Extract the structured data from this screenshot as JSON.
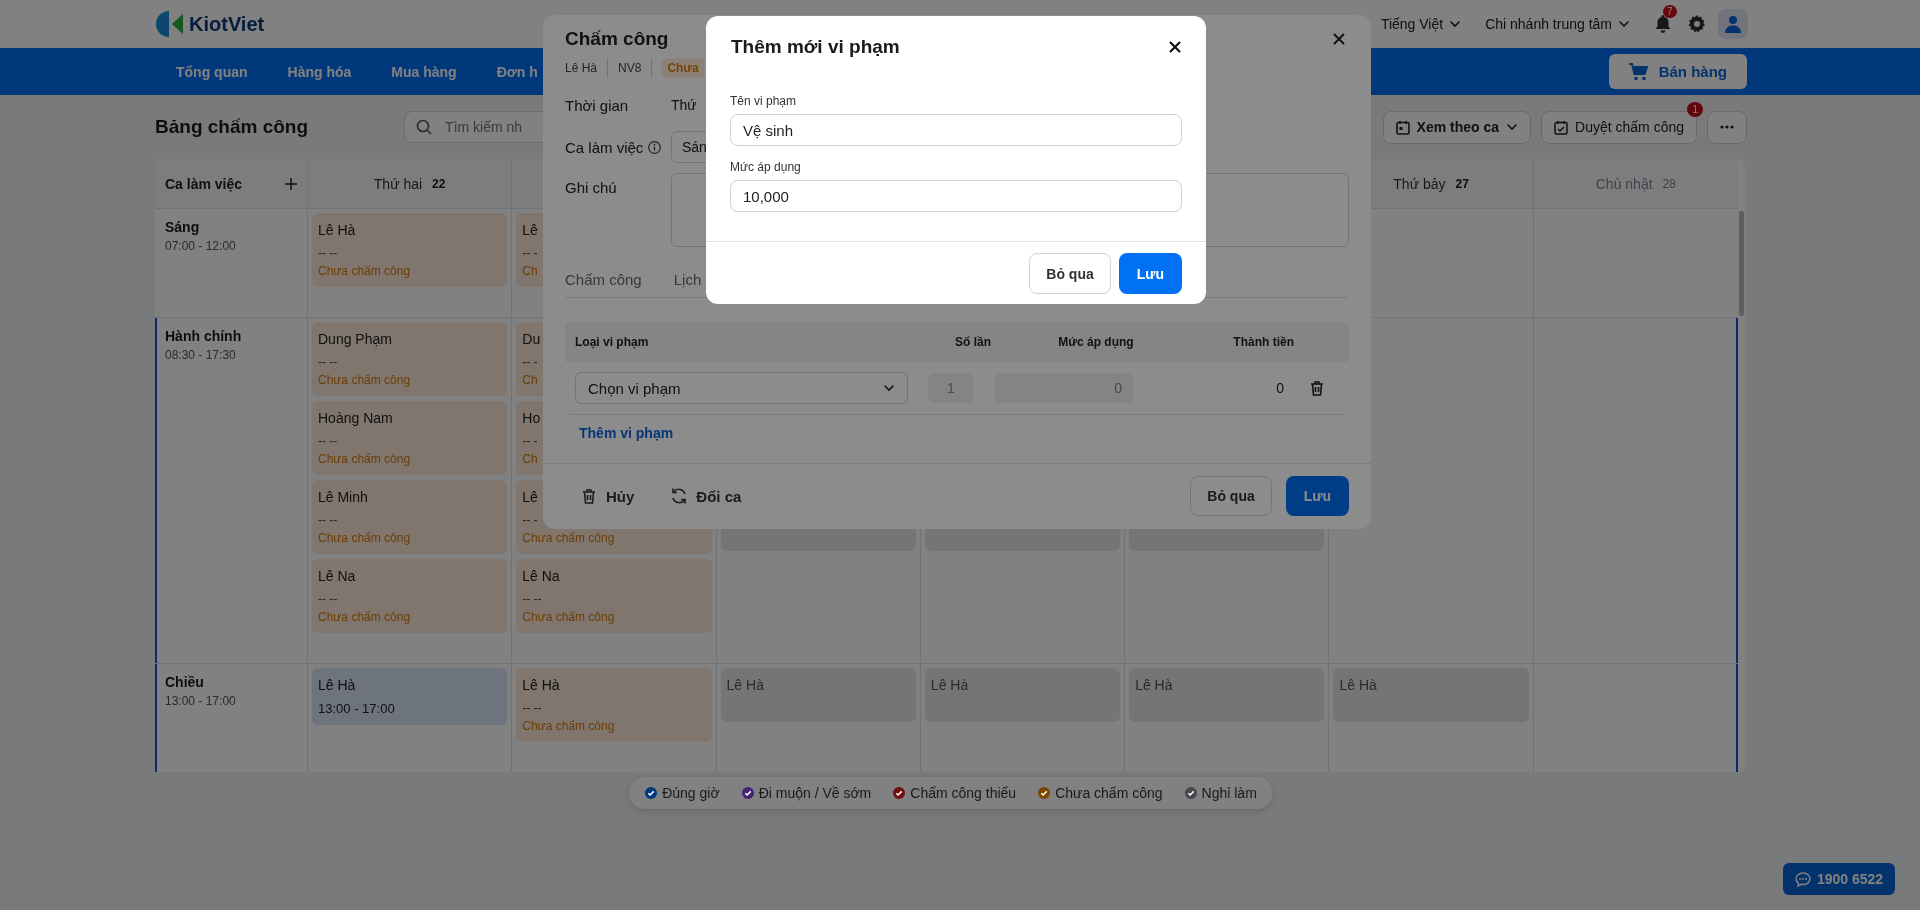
{
  "header": {
    "logo": "KiotViet",
    "language": "Tiếng Việt",
    "branch": "Chi nhánh trung tâm",
    "notification_count": "7"
  },
  "nav": {
    "items": [
      {
        "label": "Tổng quan"
      },
      {
        "label": "Hàng hóa"
      },
      {
        "label": "Mua hàng"
      },
      {
        "label": "Đơn h"
      }
    ],
    "sell_button": "Bán hàng"
  },
  "toolbar": {
    "title": "Bảng chấm công",
    "search": {
      "placeholder": "Tìm kiếm nh"
    },
    "view_button": "Xem theo ca",
    "approve_button": "Duyệt chấm công",
    "approve_badge": "1"
  },
  "schedule": {
    "shift_header": "Ca làm việc",
    "days_start": [
      {
        "name": "Thứ hai",
        "date": "22",
        "muted": false
      }
    ],
    "days_end": [
      {
        "name": "Thứ bảy",
        "date": "27",
        "muted": false
      },
      {
        "name": "Chủ nhật",
        "date": "28",
        "muted": true
      }
    ],
    "shifts": [
      {
        "name": "Sáng",
        "time": "07:00 - 12:00",
        "highlighted": false,
        "cells": [
          [
            {
              "kind": "pending",
              "name": "Lê Hà",
              "time": "-- --",
              "status": "Chưa chấm công"
            }
          ],
          [
            {
              "kind": "pending",
              "name": "Lê",
              "time": "-- -",
              "status": "Ch"
            }
          ],
          [],
          [],
          [],
          [],
          []
        ]
      },
      {
        "name": "Hành chính",
        "time": "08:30 - 17:30",
        "highlighted": true,
        "cells": [
          [
            {
              "kind": "pending",
              "name": "Dung Phạm",
              "time": "-- --",
              "status": "Chưa chấm công"
            },
            {
              "kind": "pending",
              "name": "Hoàng Nam",
              "time": "-- --",
              "status": "Chưa chấm công"
            },
            {
              "kind": "pending",
              "name": "Lê Minh",
              "time": "-- --",
              "status": "Chưa chấm công"
            },
            {
              "kind": "pending",
              "name": "Lê Na",
              "time": "-- --",
              "status": "Chưa chấm công"
            }
          ],
          [
            {
              "kind": "pending",
              "name": "Du",
              "time": "-- -",
              "status": "Ch"
            },
            {
              "kind": "pending",
              "name": "Ho",
              "time": "-- -",
              "status": "Ch"
            },
            {
              "kind": "pending",
              "name": "Lê",
              "time": "-- -",
              "status": "Chưa chấm công"
            },
            {
              "kind": "pending",
              "name": "Lê Na",
              "time": "-- --",
              "status": "Chưa chấm công"
            }
          ],
          [
            {
              "kind": "blank"
            }
          ],
          [
            {
              "kind": "blank"
            }
          ],
          [
            {
              "kind": "blank"
            }
          ],
          [],
          []
        ]
      },
      {
        "name": "Chiều",
        "time": "13:00 - 17:00",
        "highlighted": true,
        "cells": [
          [
            {
              "kind": "done",
              "name": "Lê Hà",
              "time": "13:00 - 17:00"
            }
          ],
          [
            {
              "kind": "pending",
              "name": "Lê Hà",
              "time": "-- --",
              "status": "Chưa chấm công"
            }
          ],
          [
            {
              "kind": "off",
              "name": "Lê Hà"
            }
          ],
          [
            {
              "kind": "off",
              "name": "Lê Hà"
            }
          ],
          [
            {
              "kind": "off",
              "name": "Lê Hà"
            }
          ],
          [
            {
              "kind": "off",
              "name": "Lê Hà"
            }
          ],
          []
        ]
      }
    ]
  },
  "legend": [
    {
      "label": "Đúng giờ",
      "color": "#00397b"
    },
    {
      "label": "Đi muộn / Về sớm",
      "color": "#462071"
    },
    {
      "label": "Chấm công thiếu",
      "color": "#71100f"
    },
    {
      "label": "Chưa chấm công",
      "color": "#794700"
    },
    {
      "label": "Nghỉ làm",
      "color": "#46484d"
    }
  ],
  "hotline": "1900 6522",
  "attendance_dialog": {
    "title": "Chấm công",
    "employee": "Lê Hà",
    "code": "NV8",
    "status": "Chưa",
    "time_label": "Thời gian",
    "time_value": "Thứ",
    "shift_label": "Ca làm việc",
    "shift_value": "Sán",
    "note_label": "Ghi chú",
    "tabs": [
      {
        "label": "Chấm công",
        "selected": false
      },
      {
        "label": "Lịch",
        "selected": false
      }
    ],
    "violation_columns": [
      "Loại vi phạm",
      "Số lần",
      "Mức áp dụng",
      "Thành tiền"
    ],
    "violations": [
      {
        "type": "Chọn vi phạm",
        "count": "1",
        "rate": "0",
        "amount": "0"
      }
    ],
    "add_link": "Thêm vi phạm",
    "delete_button": "Hủy",
    "change_button": "Đổi ca",
    "cancel_button": "Bỏ qua",
    "save_button": "Lưu"
  },
  "violation_modal": {
    "title": "Thêm mới vi phạm",
    "fields": [
      {
        "label": "Tên vi phạm",
        "value": "Vệ sinh"
      },
      {
        "label": "Mức áp dụng",
        "value": "10,000"
      }
    ],
    "cancel_button": "Bỏ qua",
    "save_button": "Lưu"
  }
}
